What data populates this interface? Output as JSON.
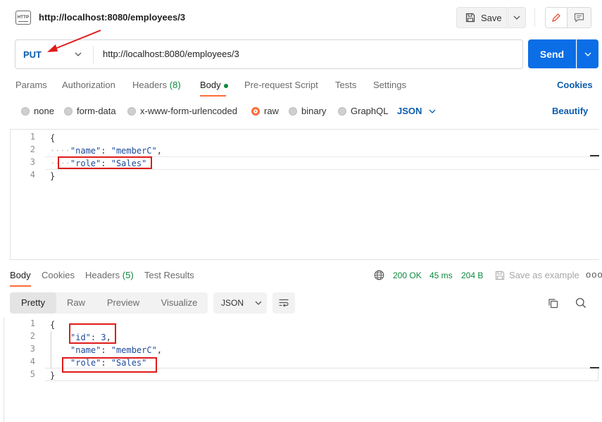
{
  "header": {
    "tab_icon_text": "HTTP",
    "tab_title": "http://localhost:8080/employees/3",
    "save_label": "Save"
  },
  "request": {
    "method": "PUT",
    "url": "http://localhost:8080/employees/3",
    "send_label": "Send"
  },
  "request_tabs": {
    "params": "Params",
    "authorization": "Authorization",
    "headers": "Headers",
    "headers_count": "(8)",
    "body": "Body",
    "prerequest": "Pre-request Script",
    "tests": "Tests",
    "settings": "Settings",
    "cookies": "Cookies"
  },
  "body_options": {
    "none": "none",
    "form_data": "form-data",
    "urlencoded": "x-www-form-urlencoded",
    "raw": "raw",
    "binary": "binary",
    "graphql": "GraphQL",
    "format": "JSON",
    "beautify": "Beautify",
    "selected": "raw"
  },
  "request_body": {
    "line_numbers": [
      "1",
      "2",
      "3",
      "4"
    ],
    "open_brace": "{",
    "close_brace": "}",
    "name_key": "\"name\"",
    "name_value": "\"memberC\"",
    "role_key": "\"role\"",
    "role_value": "\"Sales\""
  },
  "response_tabs": {
    "body": "Body",
    "cookies": "Cookies",
    "headers": "Headers",
    "headers_count": "(5)",
    "test_results": "Test Results"
  },
  "response_status": {
    "code": "200 OK",
    "time": "45 ms",
    "size": "204 B",
    "save_example": "Save as example",
    "more": "ooo"
  },
  "response_view": {
    "pretty": "Pretty",
    "raw": "Raw",
    "preview": "Preview",
    "visualize": "Visualize",
    "format": "JSON"
  },
  "response_body": {
    "line_numbers": [
      "1",
      "2",
      "3",
      "4",
      "5"
    ],
    "open_brace": "{",
    "close_brace": "}",
    "id_key": "\"id\"",
    "id_value": "3",
    "name_key": "\"name\"",
    "name_value": "\"memberC\"",
    "role_key": "\"role\"",
    "role_value": "\"Sales\""
  },
  "colors": {
    "accent": "#ff6c37",
    "primary": "#0b6ee6",
    "link": "#0b5cad",
    "success": "#0c8a3e",
    "highlight_box": "#e01b1b"
  }
}
